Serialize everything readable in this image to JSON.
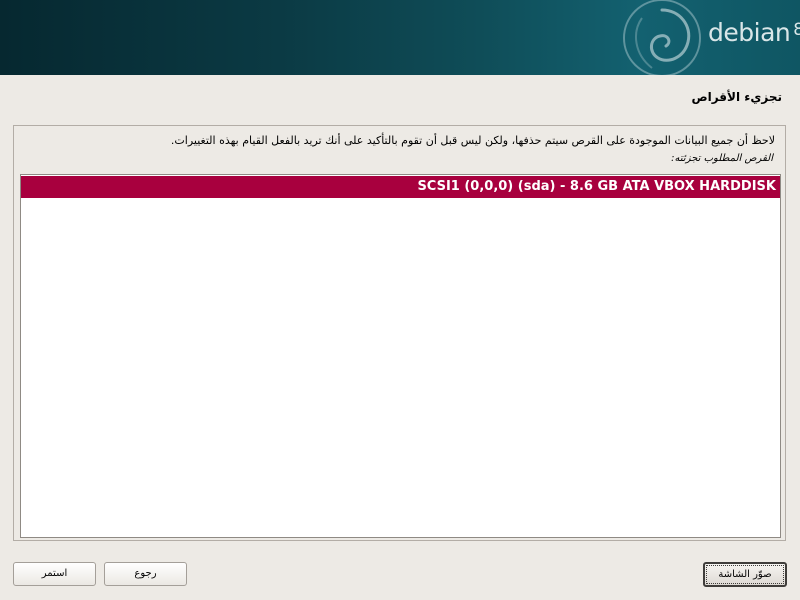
{
  "banner": {
    "brand": "debian",
    "version": "8"
  },
  "page": {
    "title": "تجزيء الأقراص",
    "note": "لاحظ أن جميع البيانات الموجودة على القرص سيتم حذفها، ولكن ليس قبل أن تقوم بالتأكيد على أنك تريد بالفعل القيام بهذه التغييرات.",
    "prompt": "القرص المطلوب تجزئته:"
  },
  "disks": [
    {
      "label": "SCSI1 (0,0,0) (sda) - 8.6 GB ATA VBOX HARDDISK",
      "selected": true
    }
  ],
  "buttons": {
    "screenshot": "صوّر الشاشة",
    "back": "رجوع",
    "continue": "استمر"
  },
  "colors": {
    "selection": "#a8003e",
    "banner": "#0b3a44",
    "background": "#edeae5"
  }
}
